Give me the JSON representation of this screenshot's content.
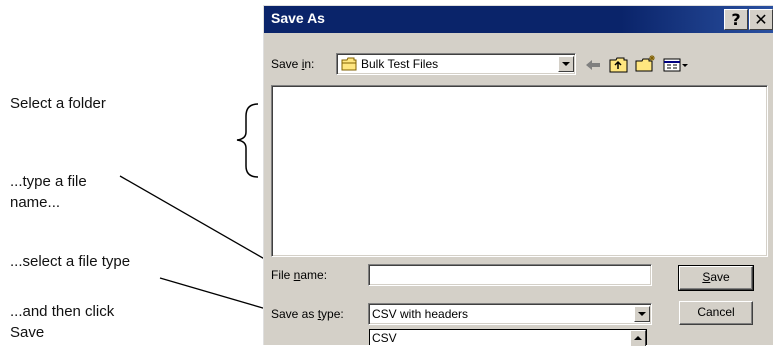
{
  "callouts": {
    "select_folder": "Select a folder",
    "type_file_line1": "...type a file",
    "type_file_line2": "name...",
    "select_type": "...select a file type",
    "click_save_line1": "...and then click",
    "click_save_line2": "Save"
  },
  "dialog": {
    "title": "Save As",
    "help_button": "?",
    "close_button": "✕",
    "save_in": {
      "label_pre": "Save ",
      "label_accel": "i",
      "label_post": "n:",
      "value": "Bulk Test Files",
      "icon": "folder-icon"
    },
    "toolbar": [
      "back-arrow-icon",
      "up-folder-icon",
      "new-folder-icon",
      "view-menu-icon"
    ],
    "file_name": {
      "label_pre": "File ",
      "label_accel": "n",
      "label_post": "ame:",
      "value": ""
    },
    "save_as_type": {
      "label_pre": "Save as ",
      "label_accel": "t",
      "label_post": "ype:",
      "value": "CSV with headers",
      "options_visible": [
        "CSV"
      ]
    },
    "buttons": {
      "save_accel": "S",
      "save_rest": "ave",
      "cancel": "Cancel"
    }
  }
}
